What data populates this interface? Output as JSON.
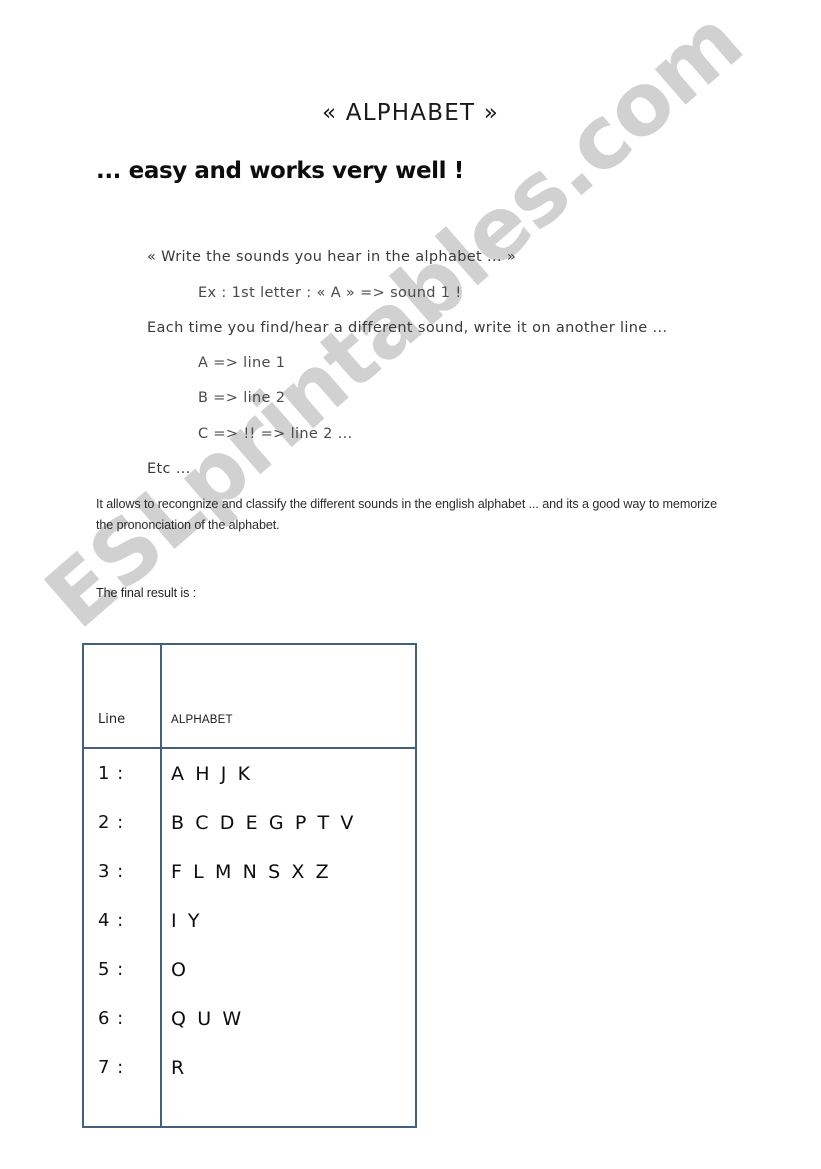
{
  "document": {
    "title": "« ALPHABET »",
    "subtitle": "... easy and works very well !",
    "instructions": [
      {
        "text": "« Write the sounds you hear in the alphabet ... »",
        "indent": 0
      },
      {
        "text": "Ex : 1st letter : « A »  => sound 1 !",
        "indent": 1
      },
      {
        "text": "Each time you find/hear a different sound, write it on another line ...",
        "indent": 0
      },
      {
        "text": "A => line 1",
        "indent": 1
      },
      {
        "text": "B => line 2",
        "indent": 1
      },
      {
        "text": "C => !! => line 2 ...",
        "indent": 1
      },
      {
        "text": "Etc ...",
        "indent": 0
      }
    ],
    "note": "It allows to recongnize and classify the different sounds in the english alphabet ... and its a good way to memorize the prononciation of the alphabet.",
    "final_result_label": "The final result is :"
  },
  "table": {
    "headers": {
      "line": "Line",
      "alphabet": "ALPHABET"
    },
    "rows": [
      {
        "line": "1 :",
        "letters": " A H J K"
      },
      {
        "line": "2 :",
        "letters": "B C D E G P T V"
      },
      {
        "line": "3 :",
        "letters": "F L M N S X Z"
      },
      {
        "line": "4 :",
        "letters": "I Y"
      },
      {
        "line": "5 :",
        "letters": "O"
      },
      {
        "line": "6 :",
        "letters": "Q U W"
      },
      {
        "line": "7 :",
        "letters": "R"
      }
    ],
    "border_color": "#44607c"
  },
  "watermark": {
    "text": "ESLprintables.com",
    "color": "#c9c9c9"
  }
}
